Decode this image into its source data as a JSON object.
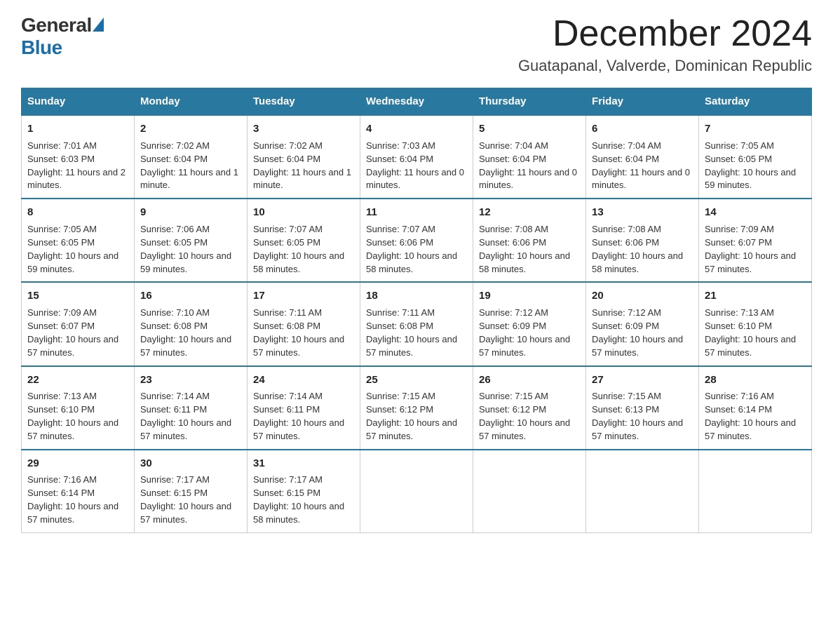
{
  "header": {
    "logo_general": "General",
    "logo_blue": "Blue",
    "month_title": "December 2024",
    "location": "Guatapanal, Valverde, Dominican Republic"
  },
  "days_of_week": [
    "Sunday",
    "Monday",
    "Tuesday",
    "Wednesday",
    "Thursday",
    "Friday",
    "Saturday"
  ],
  "weeks": [
    [
      {
        "day": "1",
        "sunrise": "7:01 AM",
        "sunset": "6:03 PM",
        "daylight": "11 hours and 2 minutes."
      },
      {
        "day": "2",
        "sunrise": "7:02 AM",
        "sunset": "6:04 PM",
        "daylight": "11 hours and 1 minute."
      },
      {
        "day": "3",
        "sunrise": "7:02 AM",
        "sunset": "6:04 PM",
        "daylight": "11 hours and 1 minute."
      },
      {
        "day": "4",
        "sunrise": "7:03 AM",
        "sunset": "6:04 PM",
        "daylight": "11 hours and 0 minutes."
      },
      {
        "day": "5",
        "sunrise": "7:04 AM",
        "sunset": "6:04 PM",
        "daylight": "11 hours and 0 minutes."
      },
      {
        "day": "6",
        "sunrise": "7:04 AM",
        "sunset": "6:04 PM",
        "daylight": "11 hours and 0 minutes."
      },
      {
        "day": "7",
        "sunrise": "7:05 AM",
        "sunset": "6:05 PM",
        "daylight": "10 hours and 59 minutes."
      }
    ],
    [
      {
        "day": "8",
        "sunrise": "7:05 AM",
        "sunset": "6:05 PM",
        "daylight": "10 hours and 59 minutes."
      },
      {
        "day": "9",
        "sunrise": "7:06 AM",
        "sunset": "6:05 PM",
        "daylight": "10 hours and 59 minutes."
      },
      {
        "day": "10",
        "sunrise": "7:07 AM",
        "sunset": "6:05 PM",
        "daylight": "10 hours and 58 minutes."
      },
      {
        "day": "11",
        "sunrise": "7:07 AM",
        "sunset": "6:06 PM",
        "daylight": "10 hours and 58 minutes."
      },
      {
        "day": "12",
        "sunrise": "7:08 AM",
        "sunset": "6:06 PM",
        "daylight": "10 hours and 58 minutes."
      },
      {
        "day": "13",
        "sunrise": "7:08 AM",
        "sunset": "6:06 PM",
        "daylight": "10 hours and 58 minutes."
      },
      {
        "day": "14",
        "sunrise": "7:09 AM",
        "sunset": "6:07 PM",
        "daylight": "10 hours and 57 minutes."
      }
    ],
    [
      {
        "day": "15",
        "sunrise": "7:09 AM",
        "sunset": "6:07 PM",
        "daylight": "10 hours and 57 minutes."
      },
      {
        "day": "16",
        "sunrise": "7:10 AM",
        "sunset": "6:08 PM",
        "daylight": "10 hours and 57 minutes."
      },
      {
        "day": "17",
        "sunrise": "7:11 AM",
        "sunset": "6:08 PM",
        "daylight": "10 hours and 57 minutes."
      },
      {
        "day": "18",
        "sunrise": "7:11 AM",
        "sunset": "6:08 PM",
        "daylight": "10 hours and 57 minutes."
      },
      {
        "day": "19",
        "sunrise": "7:12 AM",
        "sunset": "6:09 PM",
        "daylight": "10 hours and 57 minutes."
      },
      {
        "day": "20",
        "sunrise": "7:12 AM",
        "sunset": "6:09 PM",
        "daylight": "10 hours and 57 minutes."
      },
      {
        "day": "21",
        "sunrise": "7:13 AM",
        "sunset": "6:10 PM",
        "daylight": "10 hours and 57 minutes."
      }
    ],
    [
      {
        "day": "22",
        "sunrise": "7:13 AM",
        "sunset": "6:10 PM",
        "daylight": "10 hours and 57 minutes."
      },
      {
        "day": "23",
        "sunrise": "7:14 AM",
        "sunset": "6:11 PM",
        "daylight": "10 hours and 57 minutes."
      },
      {
        "day": "24",
        "sunrise": "7:14 AM",
        "sunset": "6:11 PM",
        "daylight": "10 hours and 57 minutes."
      },
      {
        "day": "25",
        "sunrise": "7:15 AM",
        "sunset": "6:12 PM",
        "daylight": "10 hours and 57 minutes."
      },
      {
        "day": "26",
        "sunrise": "7:15 AM",
        "sunset": "6:12 PM",
        "daylight": "10 hours and 57 minutes."
      },
      {
        "day": "27",
        "sunrise": "7:15 AM",
        "sunset": "6:13 PM",
        "daylight": "10 hours and 57 minutes."
      },
      {
        "day": "28",
        "sunrise": "7:16 AM",
        "sunset": "6:14 PM",
        "daylight": "10 hours and 57 minutes."
      }
    ],
    [
      {
        "day": "29",
        "sunrise": "7:16 AM",
        "sunset": "6:14 PM",
        "daylight": "10 hours and 57 minutes."
      },
      {
        "day": "30",
        "sunrise": "7:17 AM",
        "sunset": "6:15 PM",
        "daylight": "10 hours and 57 minutes."
      },
      {
        "day": "31",
        "sunrise": "7:17 AM",
        "sunset": "6:15 PM",
        "daylight": "10 hours and 58 minutes."
      },
      null,
      null,
      null,
      null
    ]
  ],
  "labels": {
    "sunrise_prefix": "Sunrise: ",
    "sunset_prefix": "Sunset: ",
    "daylight_prefix": "Daylight: "
  }
}
